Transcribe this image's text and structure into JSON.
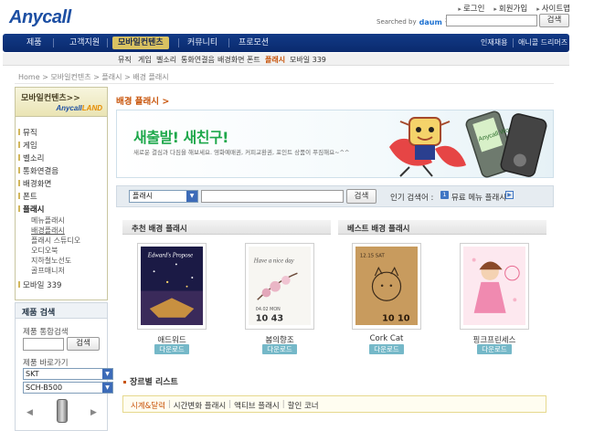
{
  "header": {
    "logo": "Anycall",
    "util_links": [
      "로그인",
      "회원가입",
      "사이트맵"
    ],
    "searched_by": "Searched by",
    "search_brand": "daum",
    "search_brand_suffix": "검색",
    "search_button": "검색"
  },
  "nav": {
    "items": [
      "제품",
      "고객지원",
      "모바일컨텐츠",
      "커뮤니티",
      "프로모션"
    ],
    "right_items": [
      "인재채용",
      "애니콜 드리머즈"
    ],
    "active": "모바일컨텐츠"
  },
  "subnav": {
    "items": [
      "뮤직",
      "게임",
      "벨소리",
      "통화연결음",
      "배경화면",
      "폰트",
      "플래시",
      "모바일 339"
    ],
    "active": "플래시"
  },
  "breadcrumb": "Home > 모바일컨텐츠 > 플래시 > 배경 플래시",
  "sidebar": {
    "title": "모바일컨텐츠>>",
    "brand_a": "Anycall",
    "brand_b": "LAND",
    "menu": [
      "뮤직",
      "게임",
      "벨소리",
      "통화연결음",
      "배경화면",
      "폰트",
      "플래시"
    ],
    "submenu": [
      "메뉴플래시",
      "배경플래시",
      "플래시 스튜디오",
      "오디오북",
      "지하철노선도",
      "골프매니저"
    ],
    "menu_last": "모바일 339",
    "active_menu": "플래시",
    "active_sub": "배경플래시"
  },
  "product_search": {
    "title": "제품 검색",
    "integrated_label": "제품 통합검색",
    "search_button": "검색",
    "shortcut_label": "제품 바로가기",
    "carrier": "SKT",
    "model": "SCH-B500",
    "prev": "◀",
    "next": "▶"
  },
  "main": {
    "page_title": "배경 플래시 >",
    "banner_headline": "새출발! 새친구!",
    "banner_desc": "새로운 결심과 다짐을 해보세요. 영화예매권, 커피교환권, 포인트 상품이 푸짐해요~^^",
    "banner_phone_label": "Anycall World",
    "search": {
      "category": "플래시",
      "button": "검색",
      "popular_label": "인기 검색어 :",
      "popular_rank": "1",
      "popular_keyword": "뮤료 메뉴 플래시",
      "more_icon": "arrow-right"
    },
    "sections": {
      "recommended": "추천 배경 플래시",
      "best": "베스트 배경 플래시"
    },
    "items": [
      {
        "name": "애드워드",
        "download": "다운로드",
        "art_title": "Edward's Propose"
      },
      {
        "name": "봄의향조",
        "download": "다운로드",
        "art_title": "Have a nice day",
        "date": "04.02 MON",
        "time": "10 43"
      },
      {
        "name": "Cork Cat",
        "download": "다운로드",
        "date": "12.15 SAT",
        "time": "10 10"
      },
      {
        "name": "핑크프린세스",
        "download": "다운로드"
      }
    ],
    "genre_title": "장르별 리스트",
    "genres": [
      "시계&달력",
      "시간변화 플래시",
      "액티브 플래시",
      "할인 코너"
    ],
    "genre_active": "시계&달력"
  },
  "colors": {
    "nav_bg": "#0e3279",
    "nav_active": "#d9c261",
    "accent_orange": "#c8540a",
    "banner_green": "#1ea84b",
    "download_btn": "#75b8c8"
  }
}
